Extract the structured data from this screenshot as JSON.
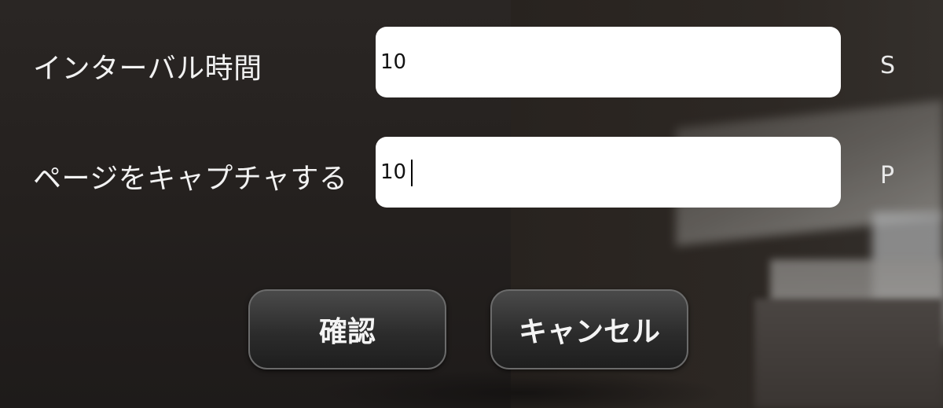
{
  "dialog": {
    "interval": {
      "label": "インターバル時間",
      "value": "10",
      "unit": "S"
    },
    "pages": {
      "label": "ページをキャプチャする",
      "value": "10",
      "unit": "P"
    },
    "buttons": {
      "confirm": "確認",
      "cancel": "キャンセル"
    }
  }
}
